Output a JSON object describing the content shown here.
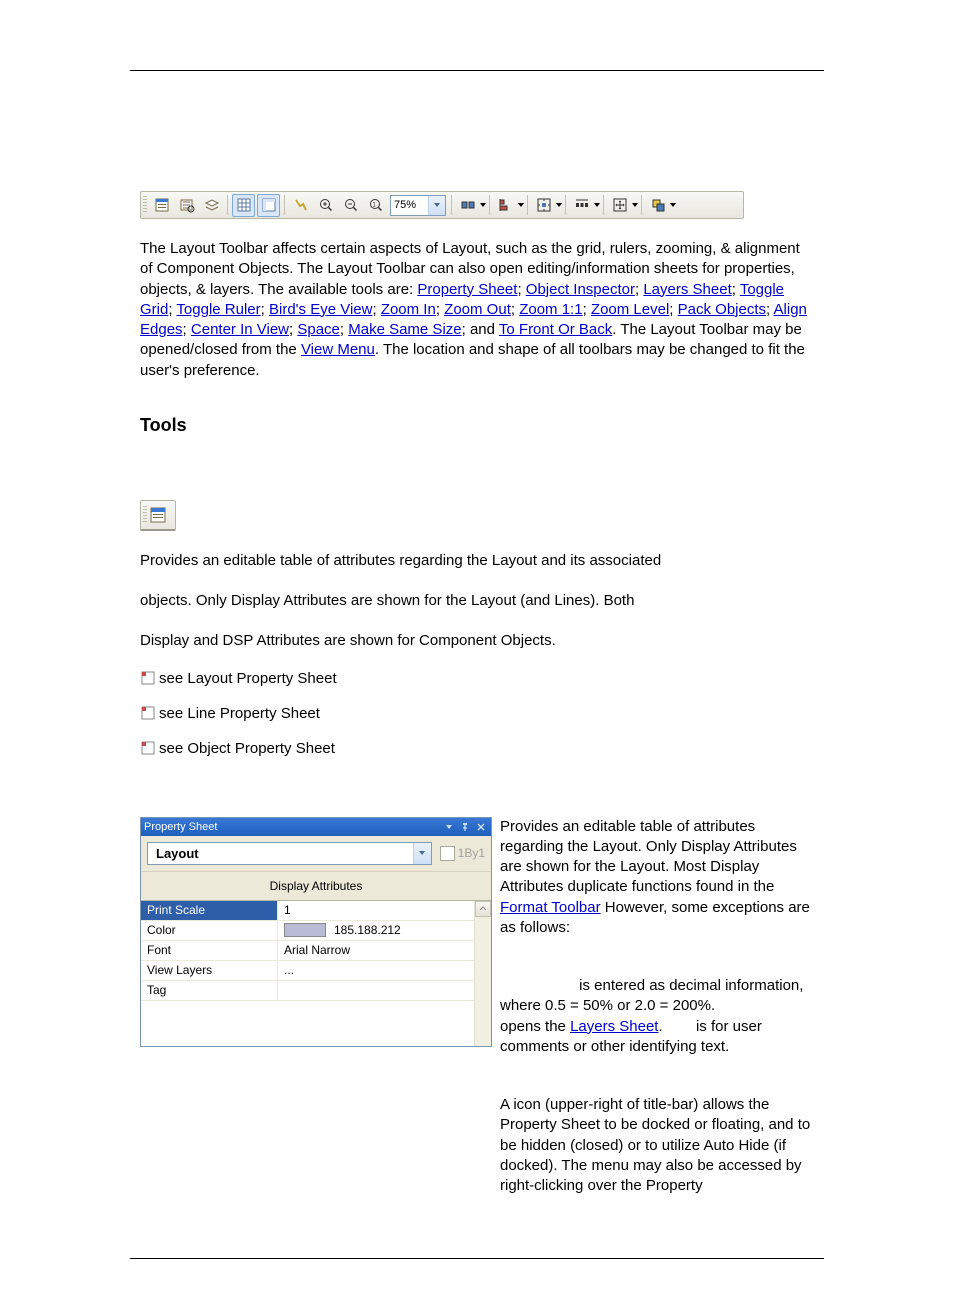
{
  "toolbar": {
    "zoom": "75%"
  },
  "intro": {
    "part1": "The Layout Toolbar affects certain aspects of Layout, such as the grid, rulers, zooming, & alignment of Component Objects. The Layout Toolbar can also open editing/information sheets for properties, objects, & layers. The available tools are: ",
    "links1": [
      "Property Sheet",
      "Object Inspector",
      "Layers Sheet",
      "Toggle Grid",
      "Toggle Ruler",
      "Bird's Eye View",
      "Zoom In",
      "Zoom Out",
      "Zoom 1:1",
      "Zoom Level",
      "Pack Objects",
      "Align Edges",
      "Center In View",
      "Space",
      "Make Same Size"
    ],
    "and": "; and ",
    "lastlink": "To Front Or Back",
    "part2": ". The Layout Toolbar may be opened/closed from the ",
    "viewmenu": "View Menu",
    "part3": ". The location and shape of all toolbars may be changed to fit the user's preference."
  },
  "tools_heading": "Tools",
  "provides1": "Provides an editable table of attributes regarding the Layout and its associated",
  "provides2": "objects. Only Display Attributes are shown for the Layout (and Lines). Both",
  "provides3": "Display and DSP Attributes are shown for Component Objects.",
  "see1": "see Layout Property Sheet",
  "see2": "see Line Property Sheet",
  "see3": "see Object Property Sheet",
  "ps": {
    "title": "Property Sheet",
    "combo": "Layout",
    "check": "1By1",
    "tab": "Display Attributes",
    "rows": [
      {
        "k": "Print Scale",
        "v": "1"
      },
      {
        "k": "Color",
        "v": "185.188.212"
      },
      {
        "k": "Font",
        "v": "Arial Narrow"
      },
      {
        "k": "View Layers",
        "v": "..."
      },
      {
        "k": "Tag",
        "v": ""
      }
    ]
  },
  "right": {
    "p1a": "Provides an editable table of attributes regarding the Layout. Only Display Attributes are shown for the Layout. Most Display Attributes duplicate functions found in the ",
    "p1link": "Format Toolbar",
    "p1b": " However, some exceptions are as follows:",
    "p2a": " is entered as decimal information, where 0.5 = 50% or 2.0 = 200%.",
    "p2b": "opens the ",
    "p2link": "Layers Sheet",
    "p2c": ".        is for user comments or other identifying text.",
    "p3": "A          icon (upper-right of title-bar) allows the Property Sheet to be docked or floating, and to be hidden (closed) or to utilize Auto Hide (if docked). The menu may also be accessed by right-clicking over the Property"
  }
}
